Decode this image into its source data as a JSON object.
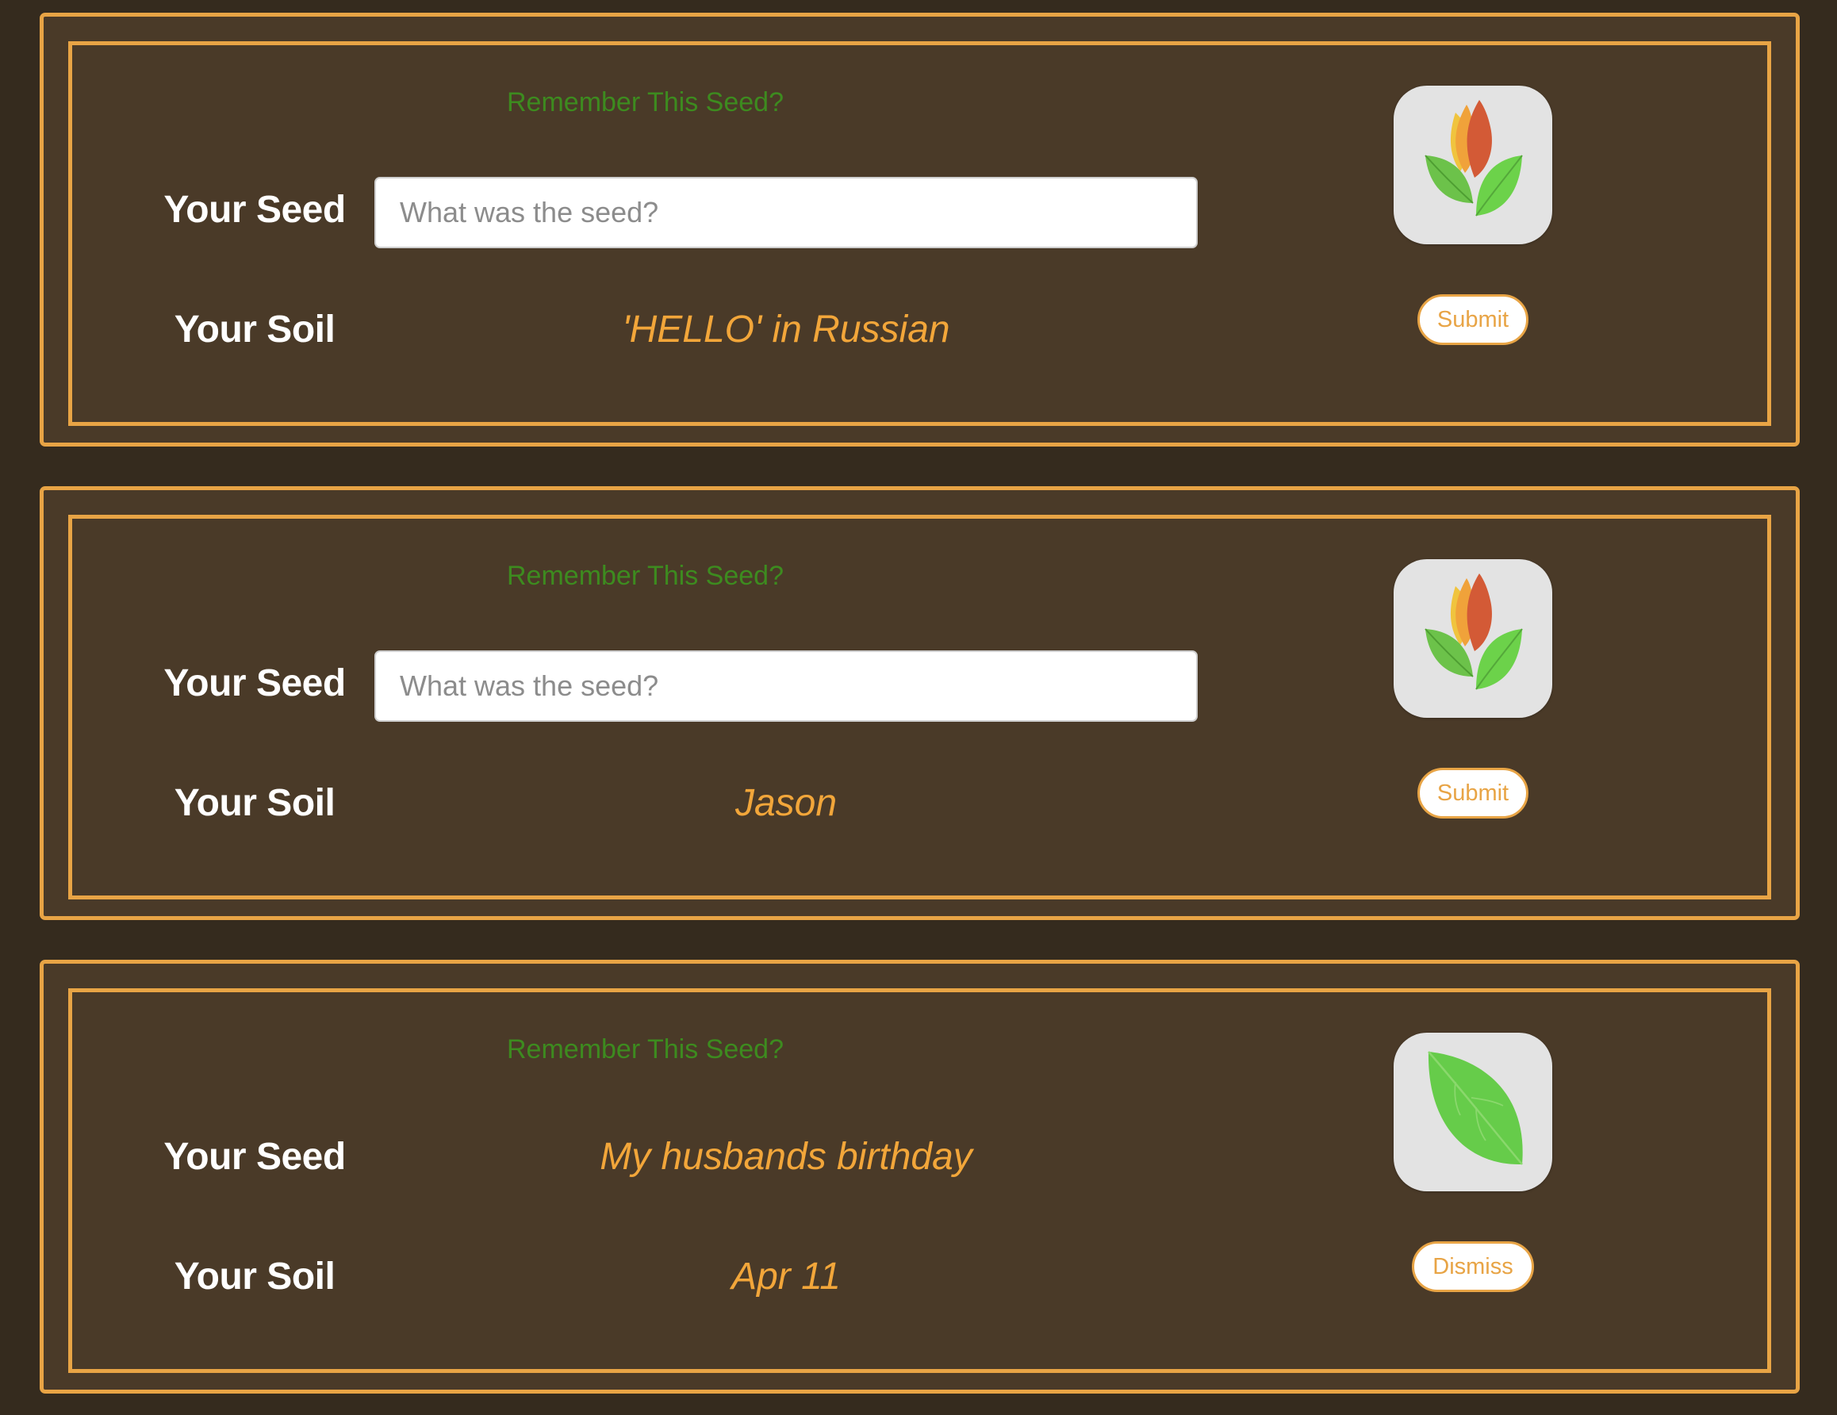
{
  "cards": [
    {
      "remember": "Remember This Seed?",
      "seed_label": "Your Seed",
      "soil_label": "Your Soil",
      "seed_placeholder": "What was the seed?",
      "soil_value": "'HELLO' in Russian",
      "icon": "seedling-flame-icon",
      "button": "Submit"
    },
    {
      "remember": "Remember This Seed?",
      "seed_label": "Your Seed",
      "soil_label": "Your Soil",
      "seed_placeholder": "What was the seed?",
      "soil_value": "Jason",
      "icon": "seedling-flame-icon",
      "button": "Submit"
    },
    {
      "remember": "Remember This Seed?",
      "seed_label": "Your Seed",
      "soil_label": "Your Soil",
      "seed_value": "My husbands birthday",
      "soil_value": "Apr 11",
      "icon": "leaf-icon",
      "button": "Dismiss"
    }
  ],
  "colors": {
    "page_background": "#352b1e",
    "card_background": "#4a3a28",
    "border_accent": "#e8a445",
    "value_text": "#f2a63a",
    "remember_text": "#3d8b1f",
    "label_text": "#ffffff"
  }
}
